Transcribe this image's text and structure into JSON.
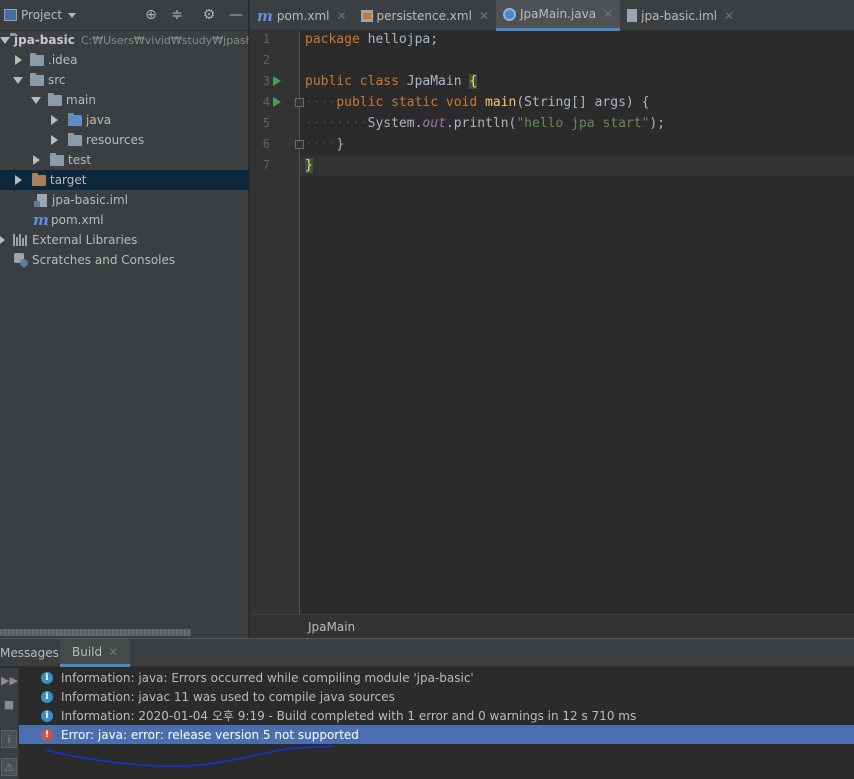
{
  "project_panel": {
    "title": "Project",
    "tree": [
      {
        "label": "jpa-basic",
        "path": "C:₩Users₩vivid₩study₩jpash"
      },
      {
        "label": ".idea"
      },
      {
        "label": "src"
      },
      {
        "label": "main"
      },
      {
        "label": "java"
      },
      {
        "label": "resources"
      },
      {
        "label": "test"
      },
      {
        "label": "target"
      },
      {
        "label": "jpa-basic.iml"
      },
      {
        "label": "pom.xml"
      },
      {
        "label": "External Libraries"
      },
      {
        "label": "Scratches and Consoles"
      }
    ]
  },
  "tabs": [
    {
      "label": "pom.xml",
      "icon": "maven-icon"
    },
    {
      "label": "persistence.xml",
      "icon": "xml-file-icon"
    },
    {
      "label": "JpaMain.java",
      "icon": "java-class-icon",
      "active": true
    },
    {
      "label": "jpa-basic.iml",
      "icon": "iml-file-icon"
    }
  ],
  "editor": {
    "line_numbers": [
      "1",
      "2",
      "3",
      "4",
      "5",
      "6",
      "7"
    ],
    "code": {
      "l1_kw": "package",
      "l1_rest": " hellojpa;",
      "l3_kw": "public class",
      "l3_name": " JpaMain ",
      "l3_brace": "{",
      "l4_kw": "public static void",
      "l4_fn": "main",
      "l4_rest": "(String[] args) {",
      "l5_a": "System.",
      "l5_field": "out",
      "l5_b": ".println(",
      "l5_str": "\"hello jpa start\"",
      "l5_c": ");",
      "l6": "}",
      "l7": "}"
    },
    "breadcrumb": "JpaMain"
  },
  "messages": {
    "label": "Messages:",
    "tab": "Build",
    "rows": [
      {
        "type": "info",
        "text": "Information: java: Errors occurred while compiling module 'jpa-basic'"
      },
      {
        "type": "info",
        "text": "Information: javac 11 was used to compile java sources"
      },
      {
        "type": "info",
        "text": "Information: 2020-01-04 오후 9:19 - Build completed with 1 error and 0 warnings in 12 s 710 ms"
      },
      {
        "type": "error",
        "text": "Error: java: error: release version 5 not supported"
      }
    ]
  },
  "colors": {
    "selection": "#4b6eaf",
    "annotation": "#1a2fd6",
    "keyword": "#cc7832",
    "string": "#6a8759"
  }
}
